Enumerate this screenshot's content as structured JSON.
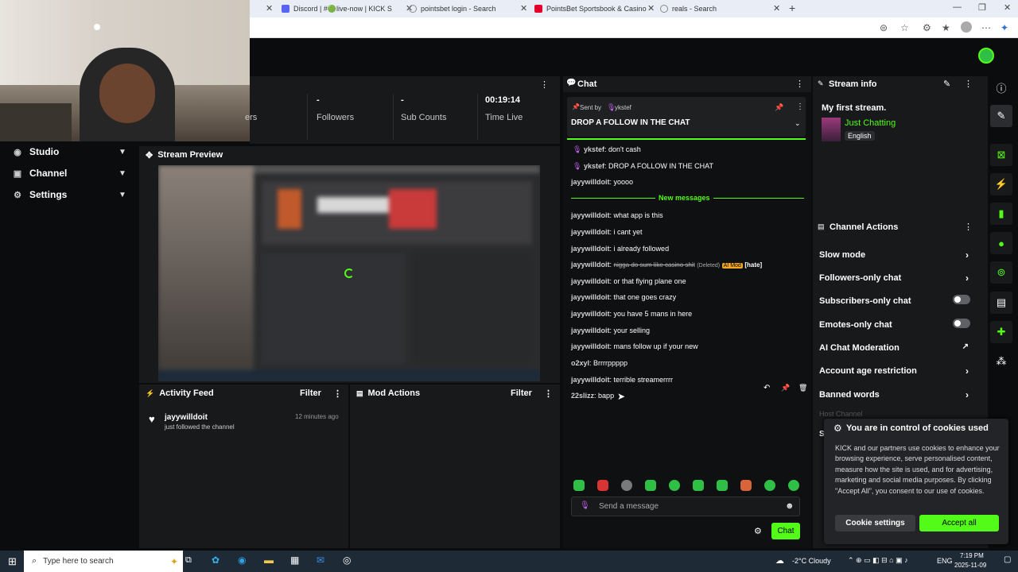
{
  "browser": {
    "tabs": [
      {
        "label": "Discord | #🟢live-now | KICK S",
        "icon": "discord-icon",
        "color": "#5865f2"
      },
      {
        "label": "pointsbet login - Search",
        "icon": "search-icon",
        "color": "#888888"
      },
      {
        "label": "PointsBet Sportsbook & Casino",
        "icon": "pointsbet-icon",
        "color": "#e4002b"
      },
      {
        "label": "reals - Search",
        "icon": "search-icon",
        "color": "#888888"
      }
    ]
  },
  "nav": {
    "items": [
      {
        "label": "Studio",
        "icon": "studio-icon"
      },
      {
        "label": "Channel",
        "icon": "channel-icon"
      },
      {
        "label": "Settings",
        "icon": "gear-icon"
      }
    ]
  },
  "stats": {
    "partial_label": "ers",
    "items": [
      {
        "value": "-",
        "label": "Followers"
      },
      {
        "value": "-",
        "label": "Sub Counts"
      },
      {
        "value": "00:19:14",
        "label": "Time Live"
      }
    ]
  },
  "preview": {
    "title": "Stream Preview"
  },
  "activity": {
    "title": "Activity Feed",
    "filter": "Filter",
    "items": [
      {
        "user": "jayywilldoit",
        "text": "just followed the channel",
        "time": "12 minutes ago"
      }
    ]
  },
  "mod": {
    "title": "Mod Actions",
    "filter": "Filter"
  },
  "chat": {
    "title": "Chat",
    "pinned": {
      "sent_by": "Sent by",
      "user": "ykstef",
      "text": "DROP A FOLLOW IN THE CHAT"
    },
    "new_messages": "New messages",
    "messages": [
      {
        "user": "ykstef",
        "text": "don't cash",
        "badge": true
      },
      {
        "user": "ykstef",
        "text": "DROP A FOLLOW IN THE CHAT",
        "badge": true
      },
      {
        "user": "jayywilldoit",
        "text": "yoooo"
      },
      {
        "user": "jayywilldoit",
        "text": "what app is this"
      },
      {
        "user": "jayywilldoit",
        "text": "i cant yet"
      },
      {
        "user": "jayywilldoit",
        "text": "i already followed"
      },
      {
        "user": "jayywilldoit",
        "text": "nigga do sum like casino shit",
        "deleted": "(Deleted)",
        "mod": "AI Mod",
        "tag": "[hate]"
      },
      {
        "user": "jayywilldoit",
        "text": "or that flying plane one"
      },
      {
        "user": "jayywilldoit",
        "text": "that one goes crazy"
      },
      {
        "user": "jayywilldoit",
        "text": "you have 5 mans in here"
      },
      {
        "user": "jayywilldoit",
        "text": "your selling"
      },
      {
        "user": "jayywilldoit",
        "text": "mans follow up if your new"
      },
      {
        "user": "o2xyl",
        "text": "Brrrrppppp"
      },
      {
        "user": "jayywilldoit",
        "text": "terrible streamerrrr"
      },
      {
        "user": "22slizz",
        "text": "bapp"
      }
    ],
    "input_placeholder": "Send a message",
    "send_label": "Chat"
  },
  "info": {
    "title": "Stream info",
    "stream_title": "My first stream.",
    "category": "Just Chatting",
    "language": "English"
  },
  "actions": {
    "title": "Channel Actions",
    "items": [
      {
        "label": "Slow mode",
        "control": "arrow"
      },
      {
        "label": "Followers-only chat",
        "control": "arrow"
      },
      {
        "label": "Subscribers-only chat",
        "control": "toggle",
        "on": false
      },
      {
        "label": "Emotes-only chat",
        "control": "toggle",
        "on": false
      },
      {
        "label": "AI Chat Moderation",
        "control": "external"
      },
      {
        "label": "Account age restriction",
        "control": "arrow"
      },
      {
        "label": "Banned words",
        "control": "arrow"
      }
    ],
    "partial_1": "Host Channel",
    "partial_2": "Se"
  },
  "cookie": {
    "title": "You are in control of cookies used",
    "body": "KICK and our partners use cookies to enhance your browsing experience, serve personalised content, measure how the site is used, and for advertising, marketing and social media purposes. By clicking \"Accept All\", you consent to our use of cookies.",
    "settings_label": "Cookie settings",
    "accept_label": "Accept all"
  },
  "taskbar": {
    "search_placeholder": "Type here to search",
    "weather": "-2°C  Cloudy",
    "lang": "ENG",
    "time": "7:19 PM",
    "date": "2025-11-09"
  },
  "colors": {
    "accent": "#53fc18",
    "ai_mod": "#f5a623",
    "panel": "#18191b"
  }
}
